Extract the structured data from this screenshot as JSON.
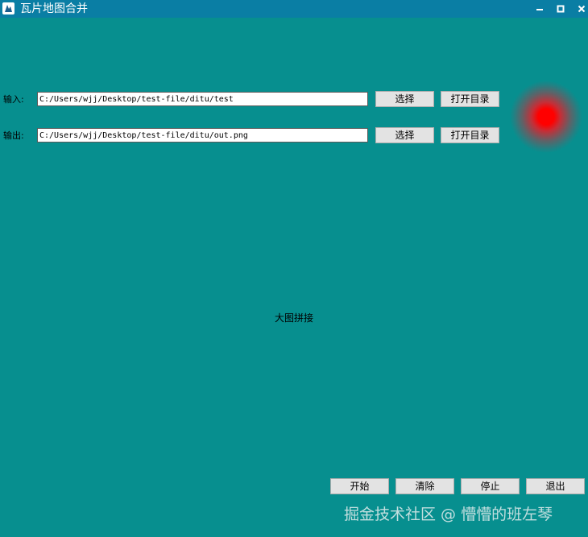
{
  "window": {
    "title": "瓦片地图合并",
    "icon": "app-logo-icon",
    "controls": [
      "minimize-icon",
      "maximize-icon",
      "close-icon"
    ]
  },
  "input_row": {
    "label": "输入:",
    "value": "C:/Users/wjj/Desktop/test-file/ditu/test",
    "select_label": "选择",
    "open_label": "打开目录"
  },
  "output_row": {
    "label": "输出:",
    "value": "C:/Users/wjj/Desktop/test-file/ditu/out.png",
    "select_label": "选择",
    "open_label": "打开目录"
  },
  "status": {
    "indicator_color": "#ff0000",
    "indicator_icon": "status-light-icon"
  },
  "main": {
    "center_text": "大图拼接"
  },
  "actions": {
    "start_label": "开始",
    "clear_label": "清除",
    "stop_label": "停止",
    "exit_label": "退出"
  },
  "watermark": {
    "text": "掘金技术社区 @ 懵懵的班左琴"
  },
  "colors": {
    "background": "#078f8f",
    "titlebar": "#0a7ea4",
    "button": "#e3e3e3"
  }
}
